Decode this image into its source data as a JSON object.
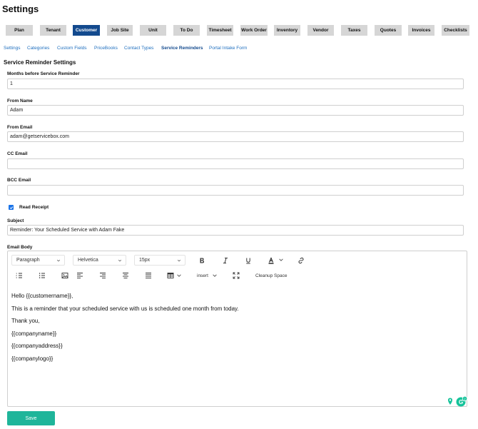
{
  "page": {
    "title": "Settings"
  },
  "tabs": [
    {
      "label": "Plan",
      "active": false
    },
    {
      "label": "Tenant",
      "active": false
    },
    {
      "label": "Customer",
      "active": true
    },
    {
      "label": "Job Site",
      "active": false
    },
    {
      "label": "Unit",
      "active": false
    },
    {
      "label": "To Do",
      "active": false
    },
    {
      "label": "Timesheet",
      "active": false
    },
    {
      "label": "Work Order",
      "active": false
    },
    {
      "label": "Inventory",
      "active": false
    },
    {
      "label": "Vendor",
      "active": false
    },
    {
      "label": "Taxes",
      "active": false
    },
    {
      "label": "Quotes",
      "active": false
    },
    {
      "label": "Invoices",
      "active": false
    },
    {
      "label": "Checklists",
      "active": false
    }
  ],
  "subnav": [
    {
      "label": "Settings",
      "active": false
    },
    {
      "label": "Categories",
      "active": false
    },
    {
      "label": "Custom Fields",
      "active": false
    },
    {
      "label": "PriceBooks",
      "active": false
    },
    {
      "label": "Contact Types",
      "active": false
    },
    {
      "label": "Service Reminders",
      "active": true
    },
    {
      "label": "Portal Intake Form",
      "active": false
    }
  ],
  "section_title": "Service Reminder Settings",
  "fields": {
    "months": {
      "label": "Months before Service Reminder",
      "value": "1"
    },
    "from_name": {
      "label": "From Name",
      "value": "Adam"
    },
    "from_email": {
      "label": "From Email",
      "value": "adam@getservicebox.com"
    },
    "cc_email": {
      "label": "CC Email",
      "value": ""
    },
    "bcc_email": {
      "label": "BCC Email",
      "value": ""
    },
    "read_receipt": {
      "label": "Read Receipt",
      "checked": true
    },
    "subject": {
      "label": "Subject",
      "value": "Reminder: Your Scheduled Service with Adam Fake"
    },
    "email_body": {
      "label": "Email Body"
    }
  },
  "editor": {
    "format": "Paragraph",
    "font": "Helvetica",
    "size": "15px",
    "insert_label": "insert",
    "cleanup_label": "Cleanup Space",
    "grammarly_count": "2",
    "body_lines": [
      "Hello {{customername}},",
      "This is a reminder that your scheduled service with us is scheduled one month from today.",
      "Thank you,",
      "{{companyname}}",
      "{{companyaddress}}",
      "{{companylogo}}"
    ]
  },
  "save_label": "Save",
  "colors": {
    "primary": "#134a8e",
    "save": "#1fb59a",
    "checkbox": "#1a73e8",
    "tab_bg": "#d6d6d6",
    "grammarly": "#15c39a"
  }
}
